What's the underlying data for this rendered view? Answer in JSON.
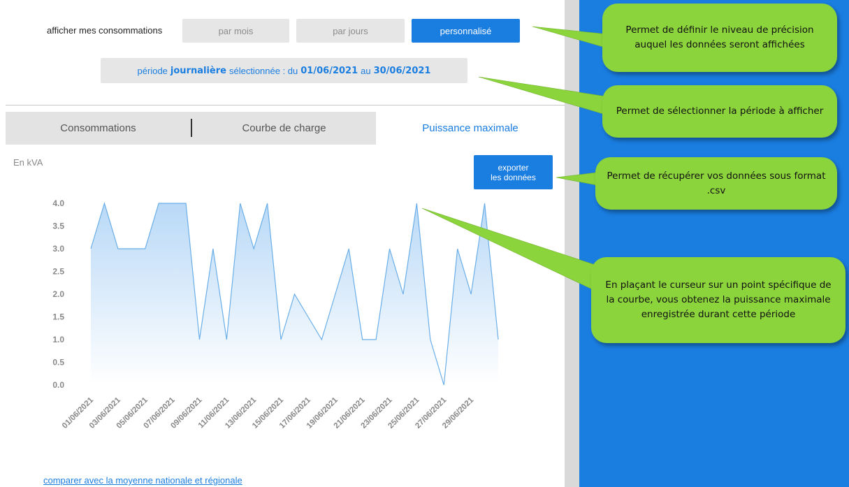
{
  "controls": {
    "display_label": "afficher mes consommations",
    "buttons": [
      {
        "label": "par mois",
        "active": false
      },
      {
        "label": "par jours",
        "active": false
      },
      {
        "label": "personnalisé",
        "active": true
      }
    ]
  },
  "period": {
    "prefix": "période",
    "granularity": "journalière",
    "middle": "sélectionnée : du",
    "start": "01/06/2021",
    "joiner": "au",
    "end": "30/06/2021"
  },
  "tabs": [
    {
      "label": "Consommations",
      "active": false
    },
    {
      "label": "Courbe de charge",
      "active": false
    },
    {
      "label": "Puissance maximale",
      "active": true
    }
  ],
  "chart": {
    "unit_label": "En kVA",
    "export_label_line1": "exporter",
    "export_label_line2": "les données"
  },
  "chart_data": {
    "type": "area",
    "title": "",
    "xlabel": "",
    "ylabel": "En kVA",
    "ylim": [
      0,
      4
    ],
    "yticks": [
      "4.0",
      "3.5",
      "3.0",
      "2.5",
      "2.0",
      "1.5",
      "1.0",
      "0.5",
      "0.0"
    ],
    "x": [
      "01/06/2021",
      "02/06/2021",
      "03/06/2021",
      "04/06/2021",
      "05/06/2021",
      "06/06/2021",
      "07/06/2021",
      "08/06/2021",
      "09/06/2021",
      "10/06/2021",
      "11/06/2021",
      "12/06/2021",
      "13/06/2021",
      "14/06/2021",
      "15/06/2021",
      "16/06/2021",
      "17/06/2021",
      "18/06/2021",
      "19/06/2021",
      "20/06/2021",
      "21/06/2021",
      "22/06/2021",
      "23/06/2021",
      "24/06/2021",
      "25/06/2021",
      "26/06/2021",
      "27/06/2021",
      "28/06/2021",
      "29/06/2021",
      "30/06/2021"
    ],
    "x_tick_labels": [
      "01/06/2021",
      "03/06/2021",
      "05/06/2021",
      "07/06/2021",
      "09/06/2021",
      "11/06/2021",
      "13/06/2021",
      "15/06/2021",
      "17/06/2021",
      "19/06/2021",
      "21/06/2021",
      "23/06/2021",
      "25/06/2021",
      "27/06/2021",
      "29/06/2021"
    ],
    "values": [
      3,
      4,
      3,
      3,
      3,
      4,
      4,
      4,
      1,
      3,
      1,
      4,
      3,
      4,
      1,
      2,
      1.5,
      1,
      2,
      3,
      1,
      1,
      3,
      2,
      4,
      1,
      0,
      3,
      2,
      4,
      1
    ],
    "line_color": "#6aaee8",
    "fill_top_color": "#b9d9f7",
    "grid": false
  },
  "links": {
    "compare": "comparer avec la moyenne nationale et régionale"
  },
  "callouts": [
    {
      "text": "Permet de définir le niveau de précision auquel les données seront affichées"
    },
    {
      "text": "Permet de sélectionner la période à afficher"
    },
    {
      "text": "Permet de récupérer vos données sous format .csv"
    },
    {
      "text": "En plaçant le curseur sur un point spécifique de la courbe, vous obtenez la puissance maximale enregistrée durant cette période"
    }
  ],
  "colors": {
    "accent": "#1a7de0",
    "callout": "#8cd43c",
    "panel": "#1a7de0"
  }
}
